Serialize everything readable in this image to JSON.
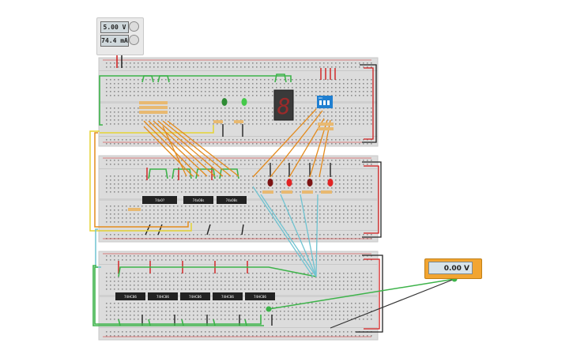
{
  "power_supply": {
    "voltage": "5.00 V",
    "current": "74.4 mA"
  },
  "multimeter": {
    "reading": "0.00 V"
  },
  "chips": {
    "row2": [
      "74x0?",
      "74x08s",
      "74x08s"
    ],
    "row3": [
      "74HC86",
      "74HC86",
      "74HC86",
      "74HC86",
      "74HC86"
    ]
  },
  "seven_segment": {
    "digit": "8"
  },
  "dip_switch": {
    "label": "ON"
  },
  "colors": {
    "breadboard": "#dcdcdc",
    "wire_green": "#3db34a",
    "wire_orange": "#e38b1d",
    "wire_cyan": "#6fc3d1",
    "wire_red": "#d11d1d",
    "wire_black": "#222222",
    "wire_yellow": "#e5d334",
    "led_red": "#c62828",
    "led_green": "#35b53a",
    "dip_blue": "#1f7fd1",
    "multimeter_body": "#f2a531"
  }
}
